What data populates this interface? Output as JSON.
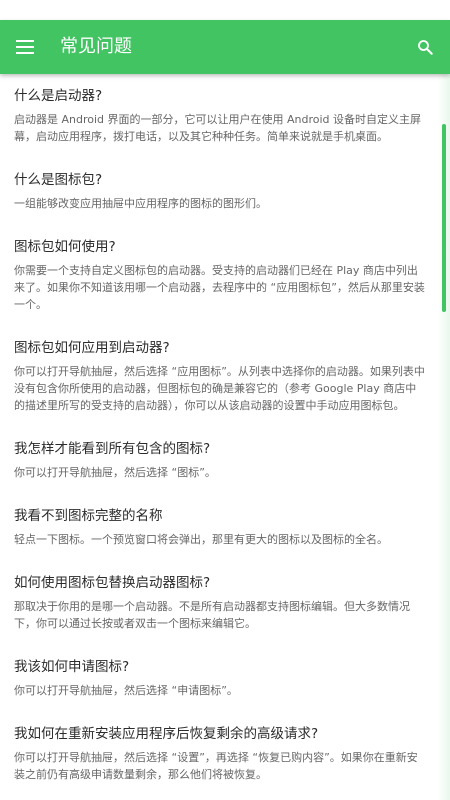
{
  "header": {
    "title": "常见问题",
    "menu_icon": "menu-icon",
    "search_icon": "search-icon"
  },
  "colors": {
    "primary": "#43c463",
    "question_text": "#2b2b2b",
    "answer_text": "#666666"
  },
  "faq": [
    {
      "question": "什么是启动器?",
      "answer": "启动器是 Android 界面的一部分，它可以让用户在使用 Android 设备时自定义主屏幕，启动应用程序，拨打电话，以及其它种种任务。简单来说就是手机桌面。"
    },
    {
      "question": "什么是图标包?",
      "answer": "一组能够改变应用抽屉中应用程序的图标的图形们。"
    },
    {
      "question": "图标包如何使用?",
      "answer": "你需要一个支持自定义图标包的启动器。受支持的启动器们已经在 Play 商店中列出来了。如果你不知道该用哪一个启动器，去程序中的 “应用图标包”，然后从那里安装一个。"
    },
    {
      "question": "图标包如何应用到启动器?",
      "answer": "你可以打开导航抽屉，然后选择 “应用图标”。从列表中选择你的启动器。如果列表中没有包含你所使用的启动器，但图标包的确是兼容它的（参考 Google Play 商店中的描述里所写的受支持的启动器），你可以从该启动器的设置中手动应用图标包。"
    },
    {
      "question": "我怎样才能看到所有包含的图标?",
      "answer": "你可以打开导航抽屉，然后选择 “图标”。"
    },
    {
      "question": "我看不到图标完整的名称",
      "answer": "轻点一下图标。一个预览窗口将会弹出，那里有更大的图标以及图标的全名。"
    },
    {
      "question": "如何使用图标包替换启动器图标?",
      "answer": "那取决于你用的是哪一个启动器。不是所有启动器都支持图标编辑。但大多数情况下，你可以通过长按或者双击一个图标来编辑它。"
    },
    {
      "question": "我该如何申请图标?",
      "answer": "你可以打开导航抽屉，然后选择 “申请图标”。"
    },
    {
      "question": "我如何在重新安装应用程序后恢复剩余的高级请求?",
      "answer": "你可以打开导航抽屉，然后选择 “设置”，再选择 “恢复已购内容”。如果你在重新安装之前仍有高级申请数量剩余，那么他们将被恢复。"
    }
  ]
}
